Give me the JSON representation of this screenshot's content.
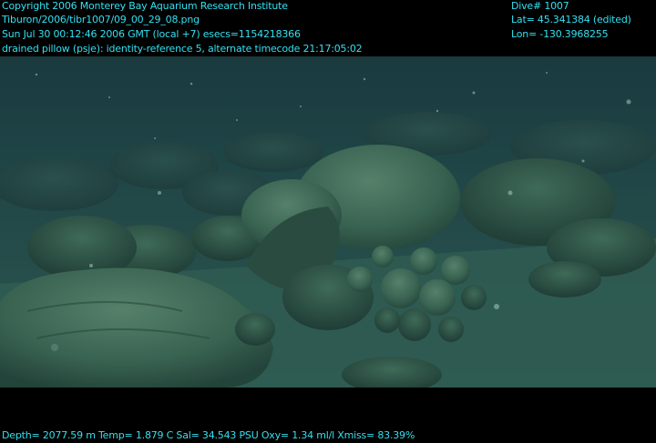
{
  "header": {
    "copyright": "Copyright 2006 Monterey Bay Aquarium Research Institute",
    "file_path": "Tiburon/2006/tibr1007/09_00_29_08.png",
    "timestamp": "Sun Jul 30 00:12:46 2006 GMT (local +7)  esecs=1154218366",
    "annotation": "drained pillow (psje): identity-reference 5, alternate timecode 21:17:05:02"
  },
  "nav": {
    "dive": "Dive# 1007",
    "lat": "Lat= 45.341384 (edited)",
    "lon": "Lon= -130.3968255"
  },
  "footer": {
    "sensors": "Depth= 2077.59 m  Temp= 1.879 C  Sal= 34.543 PSU  Oxy= 1.34 ml/l  Xmiss= 83.39%"
  },
  "colors": {
    "overlay_text": "#33e0f0",
    "background": "#000000",
    "water": "#1f4446",
    "seafloor": "#2e5a52",
    "rock": "#3c6856"
  }
}
